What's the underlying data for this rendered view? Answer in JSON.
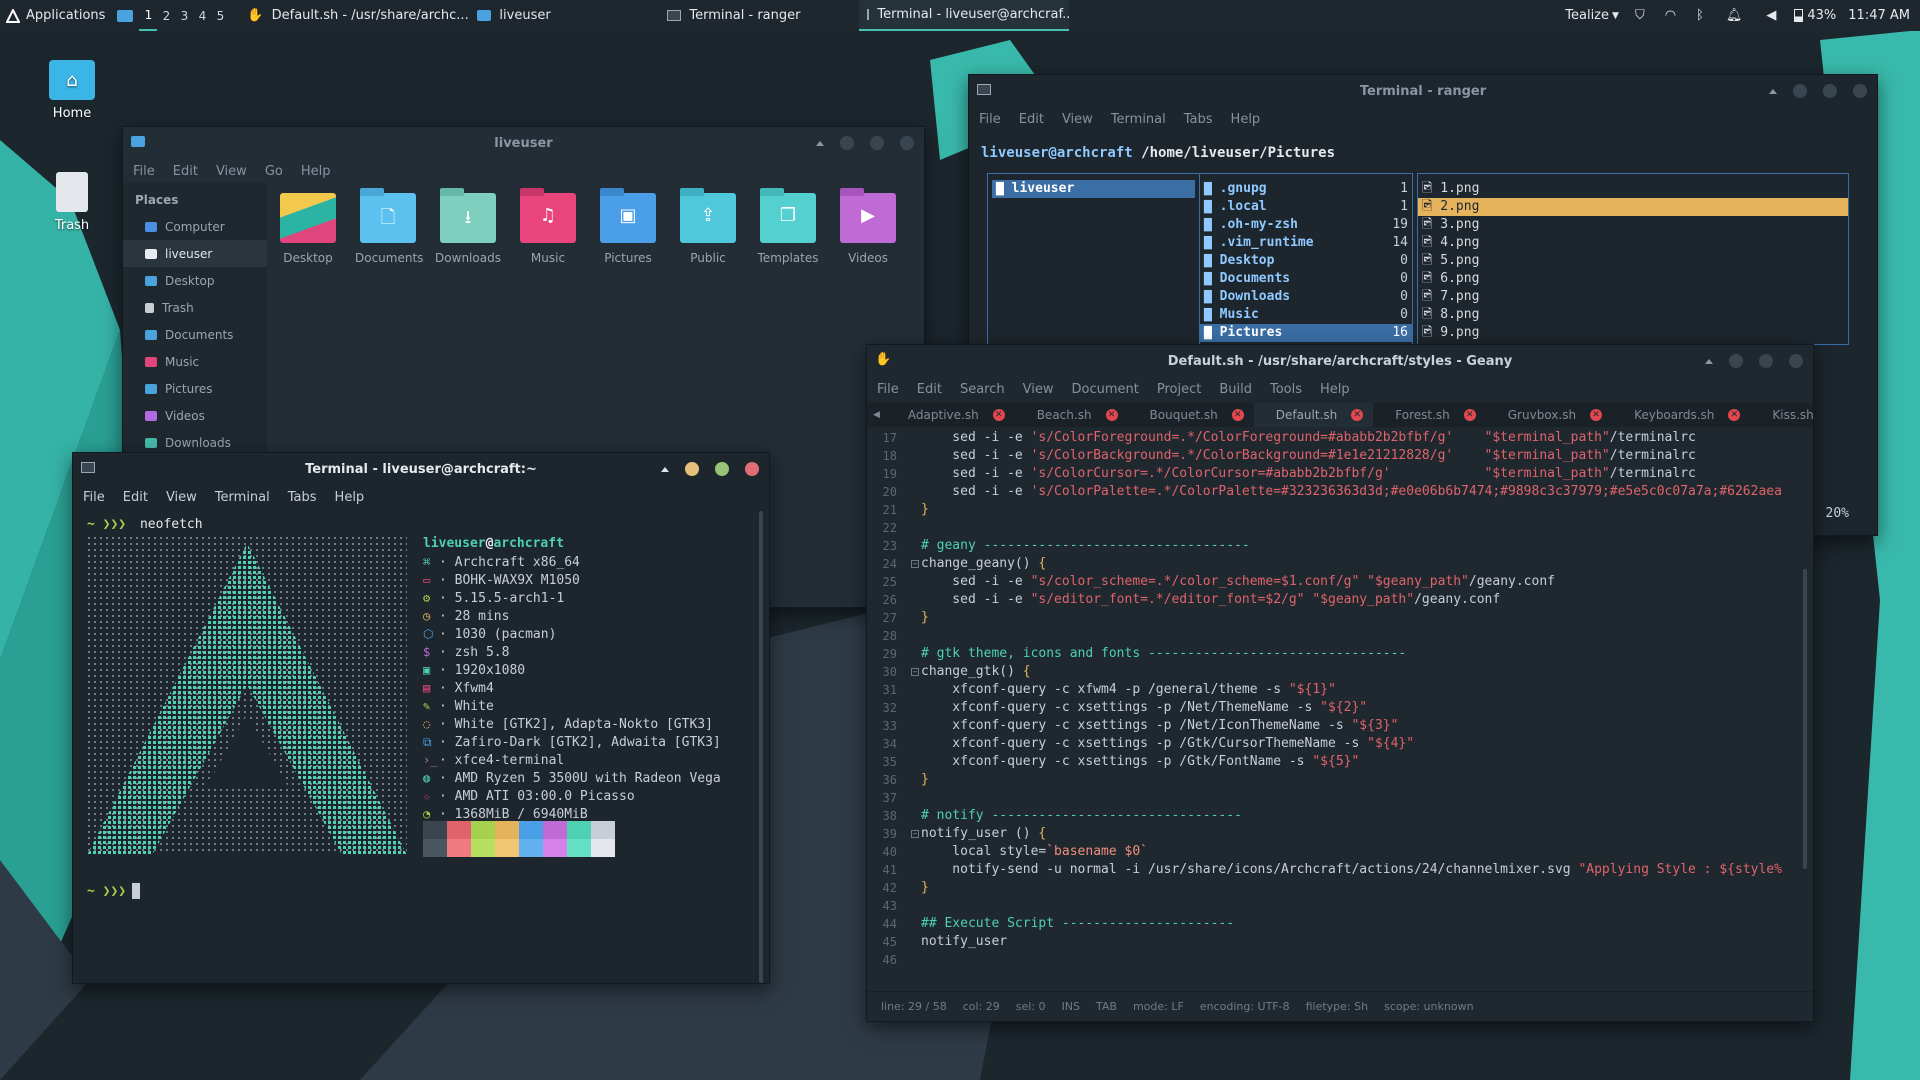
{
  "panel": {
    "apps_label": "Applications",
    "workspaces": [
      "1",
      "2",
      "3",
      "4",
      "5"
    ],
    "tasks": [
      {
        "label": "Default.sh - /usr/share/archc...",
        "icon": "geany-icon"
      },
      {
        "label": "liveuser",
        "icon": "folder-icon"
      },
      {
        "label": "Terminal - ranger",
        "icon": "terminal-icon"
      },
      {
        "label": "Terminal - liveuser@archcraf...",
        "icon": "terminal-icon"
      }
    ],
    "kbd_layout": "Tealize",
    "battery": "43%",
    "time": "11:47 AM"
  },
  "desktop": {
    "icons": [
      {
        "label": "Home",
        "icon": "home-folder-icon"
      },
      {
        "label": "Trash",
        "icon": "trash-icon"
      }
    ]
  },
  "fm": {
    "title": "liveuser",
    "menu": [
      "File",
      "Edit",
      "View",
      "Go",
      "Help"
    ],
    "places_heading": "Places",
    "places": [
      {
        "label": "Computer",
        "color": "#4a90e2"
      },
      {
        "label": "liveuser",
        "color": "#e8ecf0"
      },
      {
        "label": "Desktop",
        "color": "#4aa3df"
      },
      {
        "label": "Trash",
        "color": "#c9ced4"
      },
      {
        "label": "Documents",
        "color": "#4aa3df"
      },
      {
        "label": "Music",
        "color": "#e0457b"
      },
      {
        "label": "Pictures",
        "color": "#4aa3df"
      },
      {
        "label": "Videos",
        "color": "#b46ae0"
      },
      {
        "label": "Downloads",
        "color": "#46b8a6"
      }
    ],
    "folders": [
      {
        "label": "Desktop",
        "color": "#2bb3a3",
        "glyph": ""
      },
      {
        "label": "Documents",
        "color": "#5cc1ee",
        "glyph": "🗋"
      },
      {
        "label": "Downloads",
        "color": "#7ecfbe",
        "glyph": "⭳"
      },
      {
        "label": "Music",
        "color": "#e8457c",
        "glyph": "♫"
      },
      {
        "label": "Pictures",
        "color": "#4a9fe8",
        "glyph": "▣"
      },
      {
        "label": "Public",
        "color": "#4fc8dc",
        "glyph": "⇪"
      },
      {
        "label": "Templates",
        "color": "#55d0d0",
        "glyph": "❐"
      },
      {
        "label": "Videos",
        "color": "#c06ad6",
        "glyph": "▶"
      }
    ]
  },
  "ranger": {
    "title": "Terminal - ranger",
    "menu": [
      "File",
      "Edit",
      "View",
      "Terminal",
      "Tabs",
      "Help"
    ],
    "prompt_user": "liveuser@archcraft",
    "prompt_path": "/home/liveuser/Pictures",
    "parent": [
      "liveuser"
    ],
    "dirs": [
      {
        "name": ".gnupg",
        "n": "1"
      },
      {
        "name": ".local",
        "n": "1"
      },
      {
        "name": ".oh-my-zsh",
        "n": "19"
      },
      {
        "name": ".vim_runtime",
        "n": "14"
      },
      {
        "name": "Desktop",
        "n": "0"
      },
      {
        "name": "Documents",
        "n": "0"
      },
      {
        "name": "Downloads",
        "n": "0"
      },
      {
        "name": "Music",
        "n": "0"
      },
      {
        "name": "Pictures",
        "n": "16"
      }
    ],
    "files": [
      "1.png",
      "2.png",
      "3.png",
      "4.png",
      "5.png",
      "6.png",
      "7.png",
      "8.png",
      "9.png"
    ],
    "percent": "20%"
  },
  "neo": {
    "title": "Terminal - liveuser@archcraft:~",
    "menu": [
      "File",
      "Edit",
      "View",
      "Terminal",
      "Tabs",
      "Help"
    ],
    "prompt": "~ ❯❯❯",
    "command": "neofetch",
    "user": "liveuser",
    "at": "@",
    "host": "archcraft",
    "info": [
      {
        "icon": "⌘",
        "color": "#4ed0b2",
        "text": "· Archcraft x86_64"
      },
      {
        "icon": "▭",
        "color": "#e0457b",
        "text": "· BOHK-WAX9X M1050"
      },
      {
        "icon": "⚙",
        "color": "#a6d04e",
        "text": "· 5.15.5-arch1-1"
      },
      {
        "icon": "◷",
        "color": "#e5b35b",
        "text": "· 28 mins"
      },
      {
        "icon": "⬡",
        "color": "#4a9fe8",
        "text": "· 1030 (pacman)"
      },
      {
        "icon": "$",
        "color": "#c06ad6",
        "text": "· zsh 5.8"
      },
      {
        "icon": "▣",
        "color": "#4ed0b2",
        "text": "· 1920x1080"
      },
      {
        "icon": "▤",
        "color": "#e0457b",
        "text": "· Xfwm4"
      },
      {
        "icon": "✎",
        "color": "#a6d04e",
        "text": "· White"
      },
      {
        "icon": "◌",
        "color": "#e5b35b",
        "text": "· White [GTK2], Adapta-Nokto [GTK3]"
      },
      {
        "icon": "⧉",
        "color": "#4a9fe8",
        "text": "· Zafiro-Dark [GTK2], Adwaita [GTK3]"
      },
      {
        "icon": "›_",
        "color": "#c06ad6",
        "text": "· xfce4-terminal"
      },
      {
        "icon": "◍",
        "color": "#4ed0b2",
        "text": "· AMD Ryzen 5 3500U with Radeon Vega"
      },
      {
        "icon": "☆",
        "color": "#e0457b",
        "text": "· AMD ATI 03:00.0 Picasso"
      },
      {
        "icon": "◔",
        "color": "#a6d04e",
        "text": "· 1368MiB / 6940MiB"
      }
    ],
    "palette_top": [
      "#3a464f",
      "#e0636b",
      "#a6d04e",
      "#e5b35b",
      "#4a9fe8",
      "#c06ad6",
      "#4ed0b2",
      "#c8ced8"
    ],
    "palette_bottom": [
      "#4a565f",
      "#f07a82",
      "#b8e060",
      "#f0c673",
      "#62b0f0",
      "#d482e8",
      "#64e0c4",
      "#e4e8ec"
    ],
    "prompt2": "~ ❯❯❯"
  },
  "geany": {
    "title": "Default.sh - /usr/share/archcraft/styles - Geany",
    "menu": [
      "File",
      "Edit",
      "Search",
      "View",
      "Document",
      "Project",
      "Build",
      "Tools",
      "Help"
    ],
    "tabs": [
      "Adaptive.sh",
      "Beach.sh",
      "Bouquet.sh",
      "Default.sh",
      "Forest.sh",
      "Gruvbox.sh",
      "Keyboards.sh",
      "Kiss.sh"
    ],
    "active_tab": "Default.sh",
    "lines": [
      {
        "n": "17",
        "parts": [
          [
            "k",
            "    sed -i -e "
          ],
          [
            "s",
            "'s/ColorForeground=.*/ColorForeground=#ababb2b2bfbf/g'"
          ],
          [
            "k",
            "    "
          ],
          [
            "s",
            "\"$terminal_path\""
          ],
          [
            "k",
            "/terminalrc"
          ]
        ]
      },
      {
        "n": "18",
        "parts": [
          [
            "k",
            "    sed -i -e "
          ],
          [
            "s",
            "'s/ColorBackground=.*/ColorBackground=#1e1e21212828/g'"
          ],
          [
            "k",
            "    "
          ],
          [
            "s",
            "\"$terminal_path\""
          ],
          [
            "k",
            "/terminalrc"
          ]
        ]
      },
      {
        "n": "19",
        "parts": [
          [
            "k",
            "    sed -i -e "
          ],
          [
            "s",
            "'s/ColorCursor=.*/ColorCursor=#ababb2b2bfbf/g'"
          ],
          [
            "k",
            "            "
          ],
          [
            "s",
            "\"$terminal_path\""
          ],
          [
            "k",
            "/terminalrc"
          ]
        ]
      },
      {
        "n": "20",
        "parts": [
          [
            "k",
            "    sed -i -e "
          ],
          [
            "s",
            "'s/ColorPalette=.*/ColorPalette=#323236363d3d;#e0e06b6b7474;#9898c3c37979;#e5e5c0c07a7a;#6262aea"
          ]
        ]
      },
      {
        "n": "21",
        "parts": [
          [
            "y",
            "}"
          ]
        ]
      },
      {
        "n": "22",
        "parts": [
          [
            "k",
            ""
          ]
        ]
      },
      {
        "n": "23",
        "parts": [
          [
            "c",
            "# geany ----------------------------------"
          ]
        ]
      },
      {
        "n": "24",
        "parts": [
          [
            "k",
            "change_geany() "
          ],
          [
            "y",
            "{"
          ]
        ]
      },
      {
        "n": "25",
        "parts": [
          [
            "k",
            "    sed -i -e "
          ],
          [
            "s",
            "\"s/color_scheme=.*/color_scheme=$1.conf/g\""
          ],
          [
            "k",
            " "
          ],
          [
            "s",
            "\"$geany_path\""
          ],
          [
            "k",
            "/geany.conf"
          ]
        ]
      },
      {
        "n": "26",
        "parts": [
          [
            "k",
            "    sed -i -e "
          ],
          [
            "s",
            "\"s/editor_font=.*/editor_font=$2/g\""
          ],
          [
            "k",
            " "
          ],
          [
            "s",
            "\"$geany_path\""
          ],
          [
            "k",
            "/geany.conf"
          ]
        ]
      },
      {
        "n": "27",
        "parts": [
          [
            "y",
            "}"
          ]
        ]
      },
      {
        "n": "28",
        "parts": [
          [
            "k",
            ""
          ]
        ]
      },
      {
        "n": "29",
        "parts": [
          [
            "c",
            "# gtk theme, icons and fonts ---------------------------------"
          ]
        ]
      },
      {
        "n": "30",
        "parts": [
          [
            "k",
            "change_gtk() "
          ],
          [
            "y",
            "{"
          ]
        ]
      },
      {
        "n": "31",
        "parts": [
          [
            "k",
            "    xfconf-query -c xfwm4 -p /general/theme -s "
          ],
          [
            "s",
            "\"${1}\""
          ]
        ]
      },
      {
        "n": "32",
        "parts": [
          [
            "k",
            "    xfconf-query -c xsettings -p /Net/ThemeName -s "
          ],
          [
            "s",
            "\"${2}\""
          ]
        ]
      },
      {
        "n": "33",
        "parts": [
          [
            "k",
            "    xfconf-query -c xsettings -p /Net/IconThemeName -s "
          ],
          [
            "s",
            "\"${3}\""
          ]
        ]
      },
      {
        "n": "34",
        "parts": [
          [
            "k",
            "    xfconf-query -c xsettings -p /Gtk/CursorThemeName -s "
          ],
          [
            "s",
            "\"${4}\""
          ]
        ]
      },
      {
        "n": "35",
        "parts": [
          [
            "k",
            "    xfconf-query -c xsettings -p /Gtk/FontName -s "
          ],
          [
            "s",
            "\"${5}\""
          ]
        ]
      },
      {
        "n": "36",
        "parts": [
          [
            "y",
            "}"
          ]
        ]
      },
      {
        "n": "37",
        "parts": [
          [
            "k",
            ""
          ]
        ]
      },
      {
        "n": "38",
        "parts": [
          [
            "c",
            "# notify --------------------------------"
          ]
        ]
      },
      {
        "n": "39",
        "parts": [
          [
            "k",
            "notify_user () "
          ],
          [
            "y",
            "{"
          ]
        ]
      },
      {
        "n": "40",
        "parts": [
          [
            "k",
            "    local style="
          ],
          [
            "v",
            "`basename $0`"
          ]
        ]
      },
      {
        "n": "41",
        "parts": [
          [
            "k",
            "    notify-send -u normal -i /usr/share/icons/Archcraft/actions/24/channelmixer.svg "
          ],
          [
            "s",
            "\"Applying Style : ${style%"
          ]
        ]
      },
      {
        "n": "42",
        "parts": [
          [
            "y",
            "}"
          ]
        ]
      },
      {
        "n": "43",
        "parts": [
          [
            "k",
            ""
          ]
        ]
      },
      {
        "n": "44",
        "parts": [
          [
            "c",
            "## Execute Script ----------------------"
          ]
        ]
      },
      {
        "n": "45",
        "parts": [
          [
            "k",
            "notify_user"
          ]
        ]
      },
      {
        "n": "46",
        "parts": [
          [
            "k",
            ""
          ]
        ]
      }
    ],
    "status": [
      "line: 29 / 58",
      "col: 29",
      "sel: 0",
      "INS",
      "TAB",
      "mode: LF",
      "encoding: UTF-8",
      "filetype: Sh",
      "scope: unknown"
    ]
  }
}
